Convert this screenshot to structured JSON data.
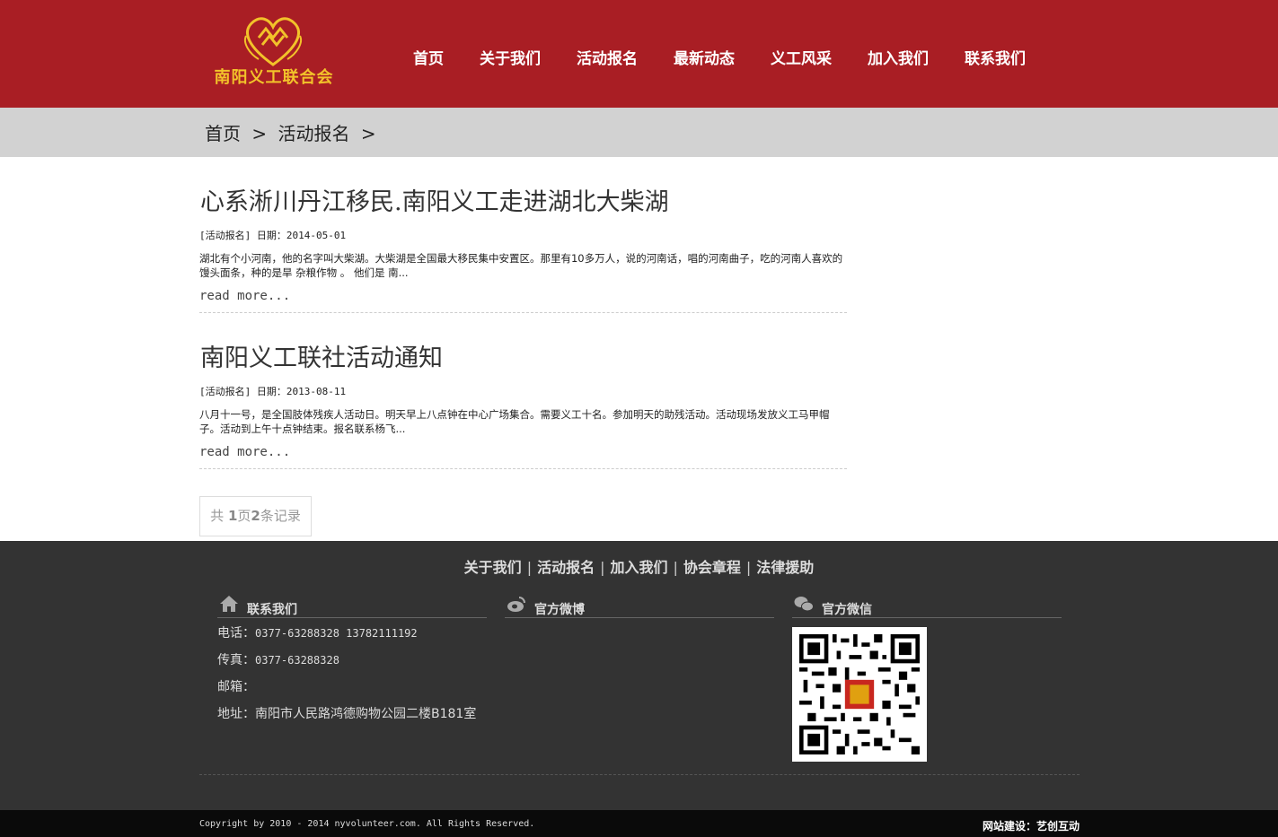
{
  "header": {
    "logo_text": "南阳义工联合会",
    "nav": [
      "首页",
      "关于我们",
      "活动报名",
      "最新动态",
      "义工风采",
      "加入我们",
      "联系我们"
    ]
  },
  "breadcrumb": [
    "首页",
    ">",
    "活动报名",
    ">"
  ],
  "articles": [
    {
      "title": "心系淅川丹江移民.南阳义工走进湖北大柴湖",
      "meta": "[活动报名] 日期：2014-05-01",
      "summary": "湖北有个小河南，他的名字叫大柴湖。大柴湖是全国最大移民集中安置区。那里有10多万人，说的河南话，唱的河南曲子，吃的河南人喜欢的馒头面条，种的是旱 杂粮作物 。 他们是 南...",
      "more": "read more..."
    },
    {
      "title": "南阳义工联社活动通知",
      "meta": "[活动报名] 日期：2013-08-11",
      "summary": "八月十一号，是全国肢体残疾人活动日。明天早上八点钟在中心广场集合。需要义工十名。参加明天的助残活动。活动现场发放义工马甲帽子。活动到上午十点钟结束。报名联系杨飞...",
      "more": "read more..."
    }
  ],
  "pager": {
    "prefix": "共 ",
    "pages": "1",
    "mid": "页",
    "records": "2",
    "suffix": "条记录"
  },
  "footer": {
    "links": [
      "关于我们",
      "活动报名",
      "加入我们",
      "协会章程",
      "法律援助"
    ],
    "link_sep": "|",
    "contact_title": "联系我们",
    "weibo_title": "官方微博",
    "wechat_title": "官方微信",
    "phone_label": "电话：",
    "phone": "0377-63288328 13782111192",
    "fax_label": "传真：",
    "fax": "0377-63288328",
    "email_label": "邮箱：",
    "address_label": "地址：",
    "address": "南阳市人民路鸿德购物公园二楼B181室",
    "copyright": "Copyright by 2010 - 2014 nyvolunteer.com. All Rights Reserved.",
    "credit": "网站建设：艺创互动"
  },
  "colors": {
    "brand_red": "#a91e24",
    "logo_gold": "#f2c22a",
    "footer_bg": "#333333"
  },
  "icons": {
    "contact": "home-icon",
    "weibo": "weibo-icon",
    "wechat": "wechat-icon",
    "qr": "qr-code"
  }
}
